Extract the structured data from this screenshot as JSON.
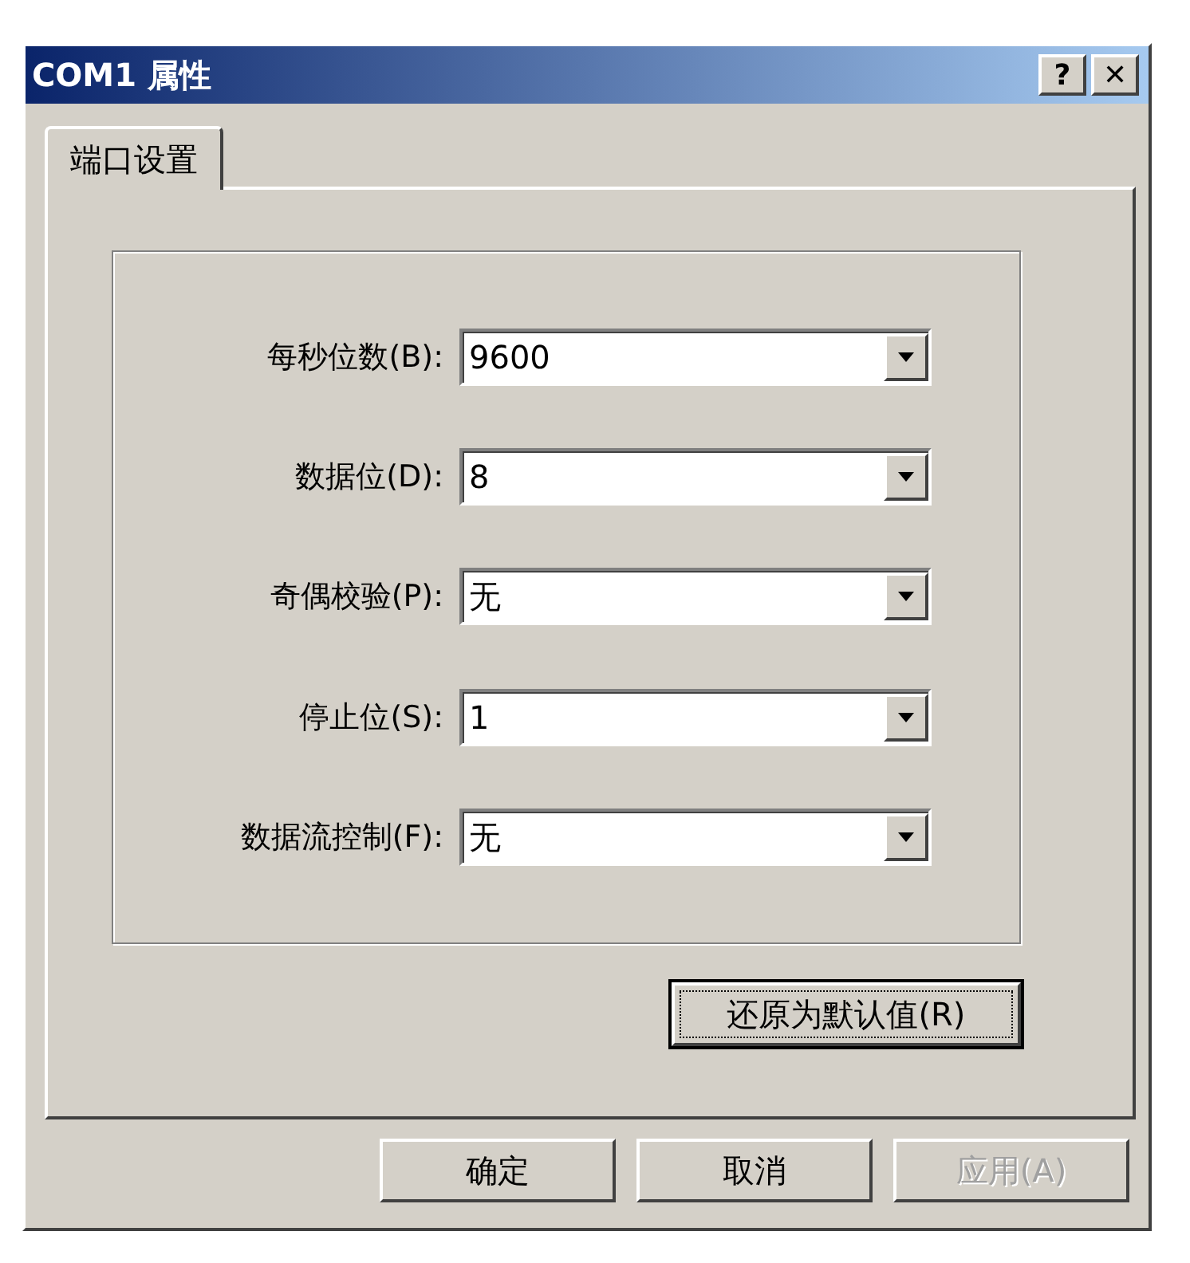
{
  "window": {
    "title": "COM1 属性",
    "help_button": "?",
    "close_button": "✕"
  },
  "tabs": [
    {
      "label": "端口设置",
      "selected": true
    }
  ],
  "settings": [
    {
      "label": "每秒位数(B):",
      "value": "9600"
    },
    {
      "label": "数据位(D):",
      "value": "8"
    },
    {
      "label": "奇偶校验(P):",
      "value": "无"
    },
    {
      "label": "停止位(S):",
      "value": "1"
    },
    {
      "label": "数据流控制(F):",
      "value": "无"
    }
  ],
  "restore_button": {
    "label": "还原为默认值(R)",
    "focused": true
  },
  "buttons": [
    {
      "label": "确定",
      "disabled": false
    },
    {
      "label": "取消",
      "disabled": false
    },
    {
      "label": "应用(A)",
      "disabled": true
    }
  ]
}
